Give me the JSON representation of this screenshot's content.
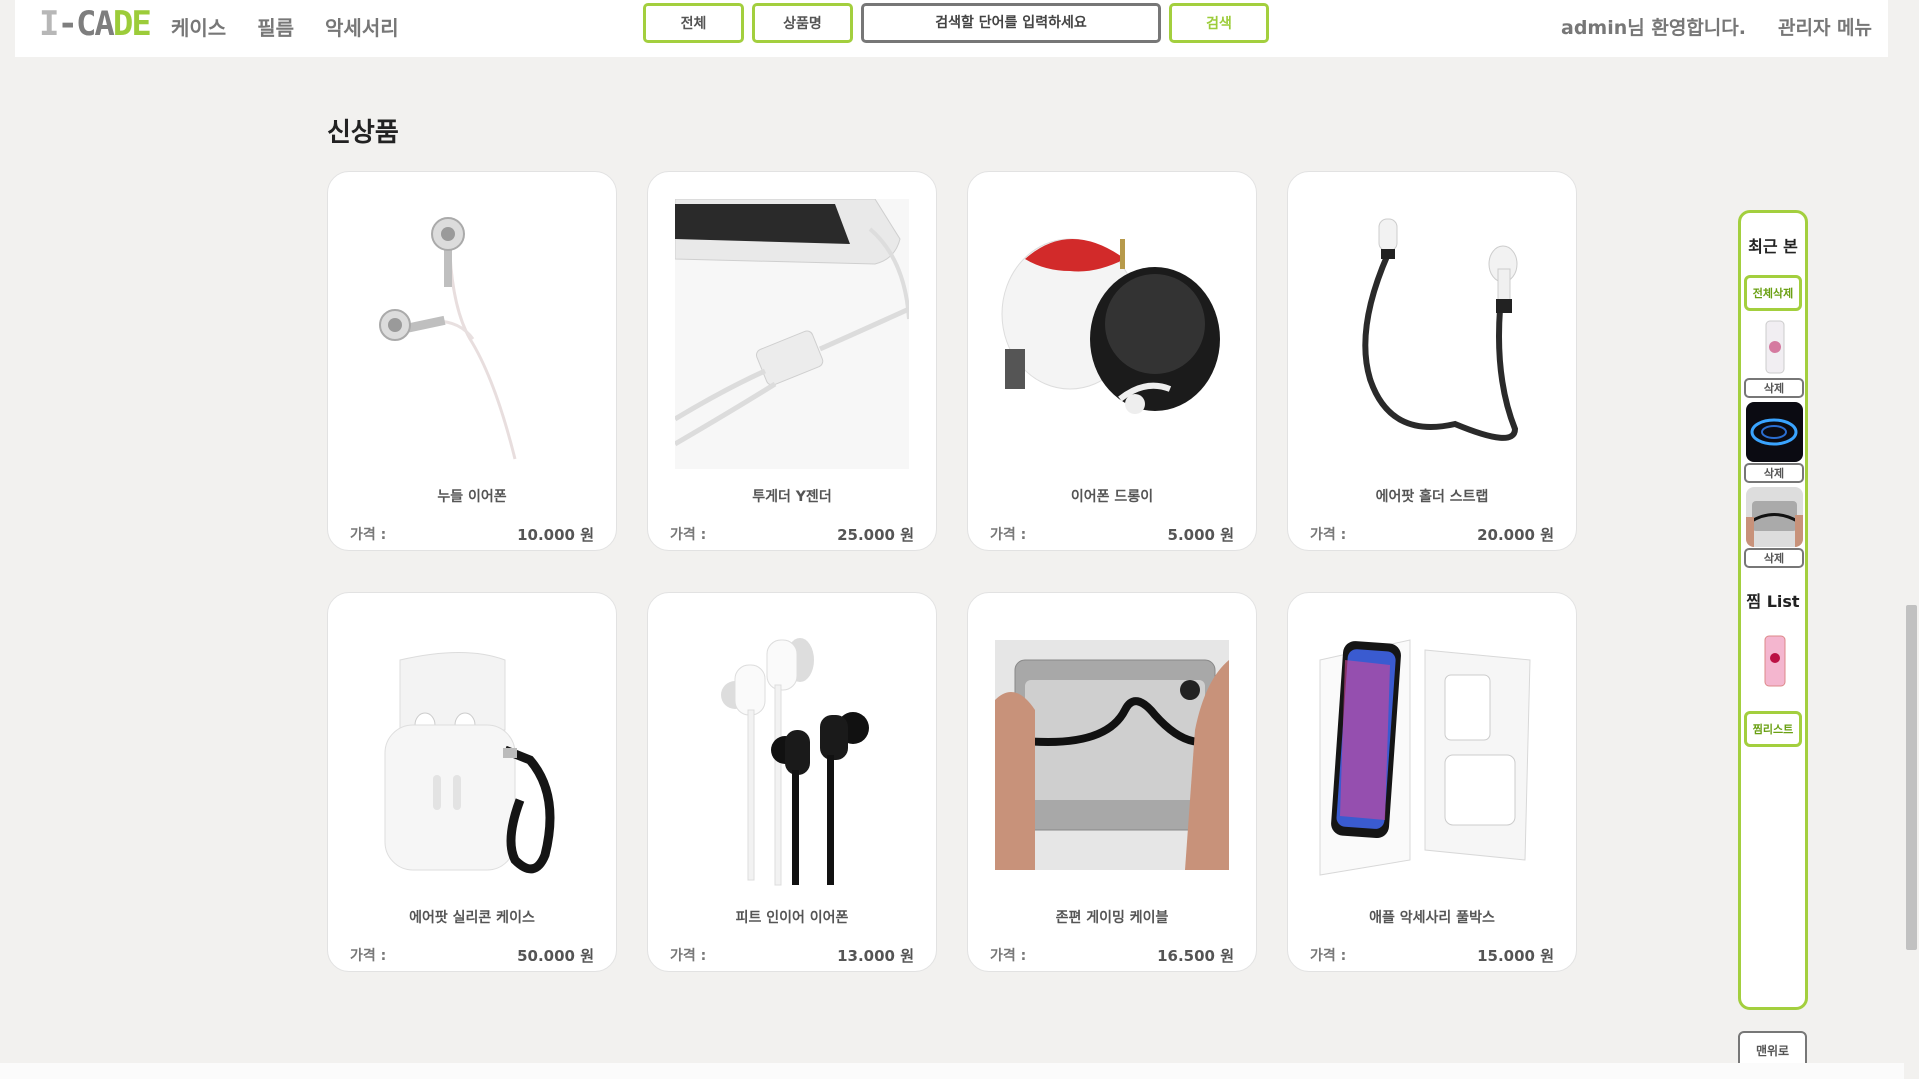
{
  "header": {
    "logo": {
      "part1": "I",
      "part2": "-CA",
      "part3": "DE"
    },
    "nav": [
      "케이스",
      "필름",
      "악세서리"
    ],
    "search": {
      "filter_all": "전체",
      "filter_name": "상품명",
      "placeholder": "검색할 단어를 입력하세요",
      "submit": "검색"
    },
    "welcome": "admin님 환영합니다.",
    "admin_menu": "관리자 메뉴"
  },
  "main": {
    "section_title": "신상품",
    "price_label": "가격 :",
    "products": [
      {
        "name": "누들 이어폰",
        "price": "10.000 원",
        "icon": "earphones-icon"
      },
      {
        "name": "투게더 Y젠더",
        "price": "25.000 원",
        "icon": "y-gender-cable-icon"
      },
      {
        "name": "이어폰 드롱이",
        "price": "5.000 원",
        "icon": "earphone-winder-icon"
      },
      {
        "name": "에어팟 홀더 스트랩",
        "price": "20.000 원",
        "icon": "airpod-strap-icon"
      },
      {
        "name": "에어팟 실리콘 케이스",
        "price": "50.000 원",
        "icon": "airpod-case-icon"
      },
      {
        "name": "피트 인이어 이어폰",
        "price": "13.000 원",
        "icon": "in-ear-earphones-icon"
      },
      {
        "name": "존편 게이밍 케이블",
        "price": "16.500 원",
        "icon": "gaming-cable-icon"
      },
      {
        "name": "애플 악세사리 풀박스",
        "price": "15.000 원",
        "icon": "iphone-fullbox-icon"
      }
    ]
  },
  "sidebar": {
    "recent_title": "최근 본",
    "clear_all": "전체삭제",
    "delete_label": "삭제",
    "wish_title": "찜 List",
    "wish_button": "찜리스트",
    "top_button": "맨위로"
  },
  "colors": {
    "accent": "#a3cf3e",
    "background": "#f2f1ef",
    "card": "#ffffff"
  }
}
